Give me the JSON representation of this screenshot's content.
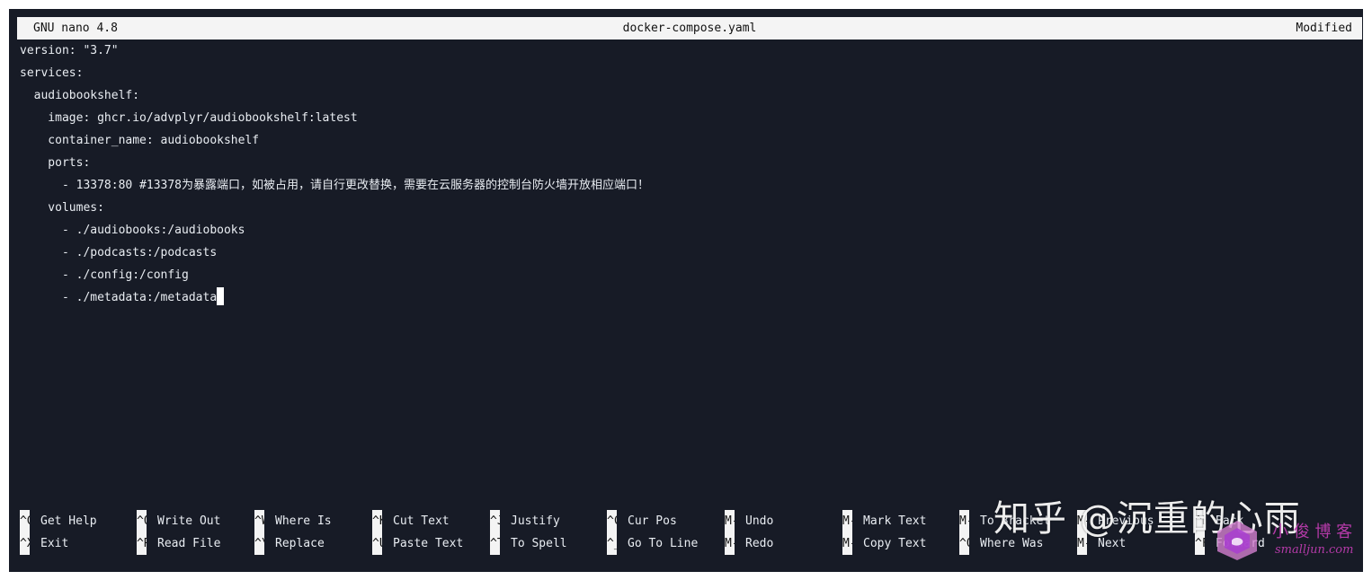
{
  "titlebar": {
    "app": "GNU nano 4.8",
    "filename": "docker-compose.yaml",
    "status": "Modified"
  },
  "editor": {
    "lines": [
      "version: \"3.7\"",
      "services:",
      "  audiobookshelf:",
      "    image: ghcr.io/advplyr/audiobookshelf:latest",
      "    container_name: audiobookshelf",
      "    ports:",
      "      - 13378:80 #13378为暴露端口，如被占用，请自行更改替换，需要在云服务器的控制台防火墙开放相应端口！",
      "    volumes:",
      "      - ./audiobooks:/audiobooks",
      "      - ./podcasts:/podcasts",
      "      - ./config:/config",
      "      - ./metadata:/metadata"
    ]
  },
  "shortcuts": {
    "row1": [
      {
        "key": "^G",
        "label": "Get Help"
      },
      {
        "key": "^O",
        "label": "Write Out"
      },
      {
        "key": "^W",
        "label": "Where Is"
      },
      {
        "key": "^K",
        "label": "Cut Text"
      },
      {
        "key": "^J",
        "label": "Justify"
      },
      {
        "key": "^C",
        "label": "Cur Pos"
      },
      {
        "key": "M-U",
        "label": "Undo"
      },
      {
        "key": "M-A",
        "label": "Mark Text"
      },
      {
        "key": "M-]",
        "label": "To Bracket"
      },
      {
        "key": "M-Q",
        "label": "Previous"
      },
      {
        "key": "^B",
        "label": "Back"
      }
    ],
    "row2": [
      {
        "key": "^X",
        "label": "Exit"
      },
      {
        "key": "^R",
        "label": "Read File"
      },
      {
        "key": "^\\",
        "label": "Replace"
      },
      {
        "key": "^U",
        "label": "Paste Text"
      },
      {
        "key": "^T",
        "label": "To Spell"
      },
      {
        "key": "^_",
        "label": "Go To Line"
      },
      {
        "key": "M-E",
        "label": "Redo"
      },
      {
        "key": "M-6",
        "label": "Copy Text"
      },
      {
        "key": "^Q",
        "label": "Where Was"
      },
      {
        "key": "M-W",
        "label": "Next"
      },
      {
        "key": "^F",
        "label": "Forward"
      }
    ]
  },
  "watermark": {
    "text": "知乎 @沉重的心雨",
    "logo_text": "小 俊 博 客",
    "logo_sub": "smalljun.com"
  },
  "colors": {
    "background": "#171b26",
    "text": "#e9edf2",
    "inverse_bg": "#f4f4f4",
    "logo": "#b33aa7"
  }
}
